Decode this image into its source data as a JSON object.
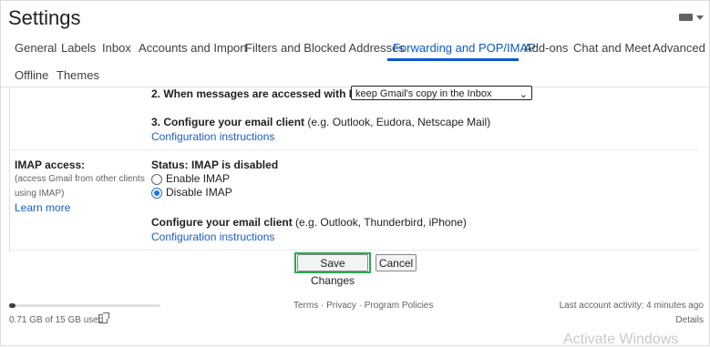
{
  "header": {
    "title": "Settings"
  },
  "tabs": [
    {
      "label": "General"
    },
    {
      "label": "Labels"
    },
    {
      "label": "Inbox"
    },
    {
      "label": "Accounts and Import"
    },
    {
      "label": "Filters and Blocked Addresses"
    },
    {
      "label": "Forwarding and POP/IMAP"
    },
    {
      "label": "Add-ons"
    },
    {
      "label": "Chat and Meet"
    },
    {
      "label": "Advanced"
    },
    {
      "label": "Offline"
    },
    {
      "label": "Themes"
    }
  ],
  "active_tab": "Forwarding and POP/IMAP",
  "pop": {
    "step2_label": "2. When messages are accessed with POP",
    "step2_select": "keep Gmail's copy in the Inbox",
    "step3_label": "3. Configure your email client",
    "step3_hint": " (e.g. Outlook, Eudora, Netscape Mail)",
    "config_link": "Configuration instructions"
  },
  "imap": {
    "label": "IMAP access:",
    "desc_line1": "(access Gmail from other clients",
    "desc_line2": "using IMAP)",
    "learn_more": "Learn more",
    "status": "Status: IMAP is disabled",
    "enable_label": "Enable IMAP",
    "disable_label": "Disable IMAP",
    "selected": "disable",
    "configure_label": "Configure your email client",
    "configure_hint": " (e.g. Outlook, Thunderbird, iPhone)",
    "config_link": "Configuration instructions"
  },
  "actions": {
    "save": "Save Changes",
    "cancel": "Cancel"
  },
  "footer": {
    "storage": "0.71 GB of 15 GB used",
    "storage_fraction": 0.047,
    "links": "Terms · Privacy · Program Policies",
    "last_activity": "Last account activity: 4 minutes ago",
    "details": "Details"
  },
  "watermark": "Activate Windows",
  "colors": {
    "accent": "#0b57d0",
    "link": "#1a5dc8",
    "highlight": "#2fa84f"
  }
}
